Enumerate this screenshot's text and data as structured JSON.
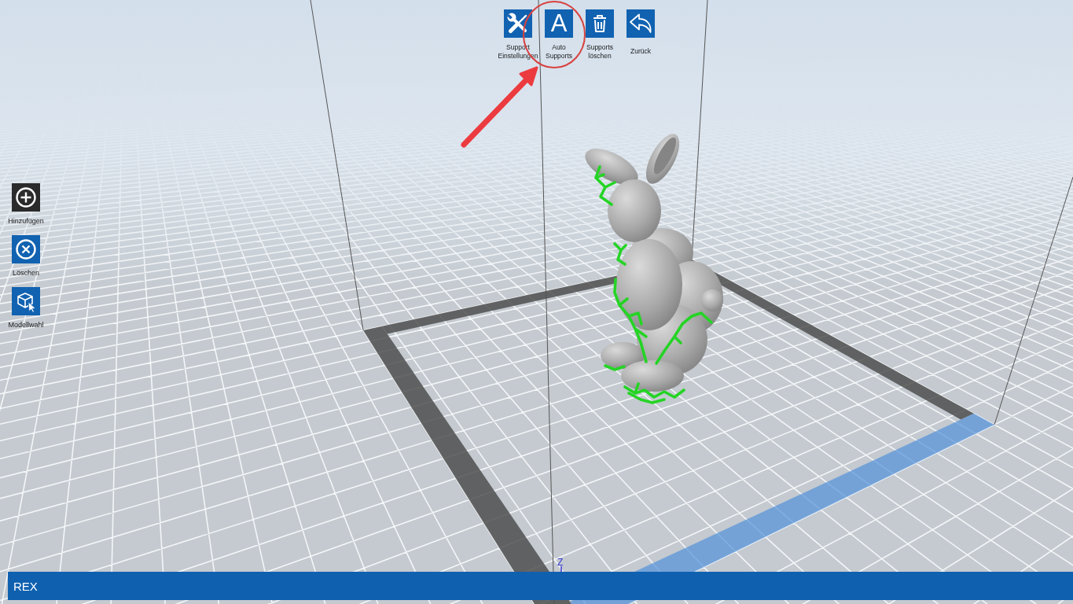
{
  "toolbar": {
    "items": [
      {
        "kind": "tools",
        "label": "Support Einstellungen",
        "annotated": false
      },
      {
        "kind": "letter",
        "icon_text": "A",
        "label": "Auto Supports",
        "annotated": true
      },
      {
        "kind": "trash",
        "label": "Supports löschen",
        "annotated": false
      },
      {
        "kind": "undo",
        "label": "Zurück",
        "annotated": false
      }
    ]
  },
  "sidebar": {
    "items": [
      {
        "kind": "add",
        "label": "Hinzufügen",
        "selected": true
      },
      {
        "kind": "remove",
        "label": "Löschen",
        "selected": false
      },
      {
        "kind": "cube",
        "label": "Modellwahl",
        "selected": false
      }
    ]
  },
  "viewport": {
    "axis_label": "Z"
  },
  "status_bar": {
    "title": "REX"
  }
}
